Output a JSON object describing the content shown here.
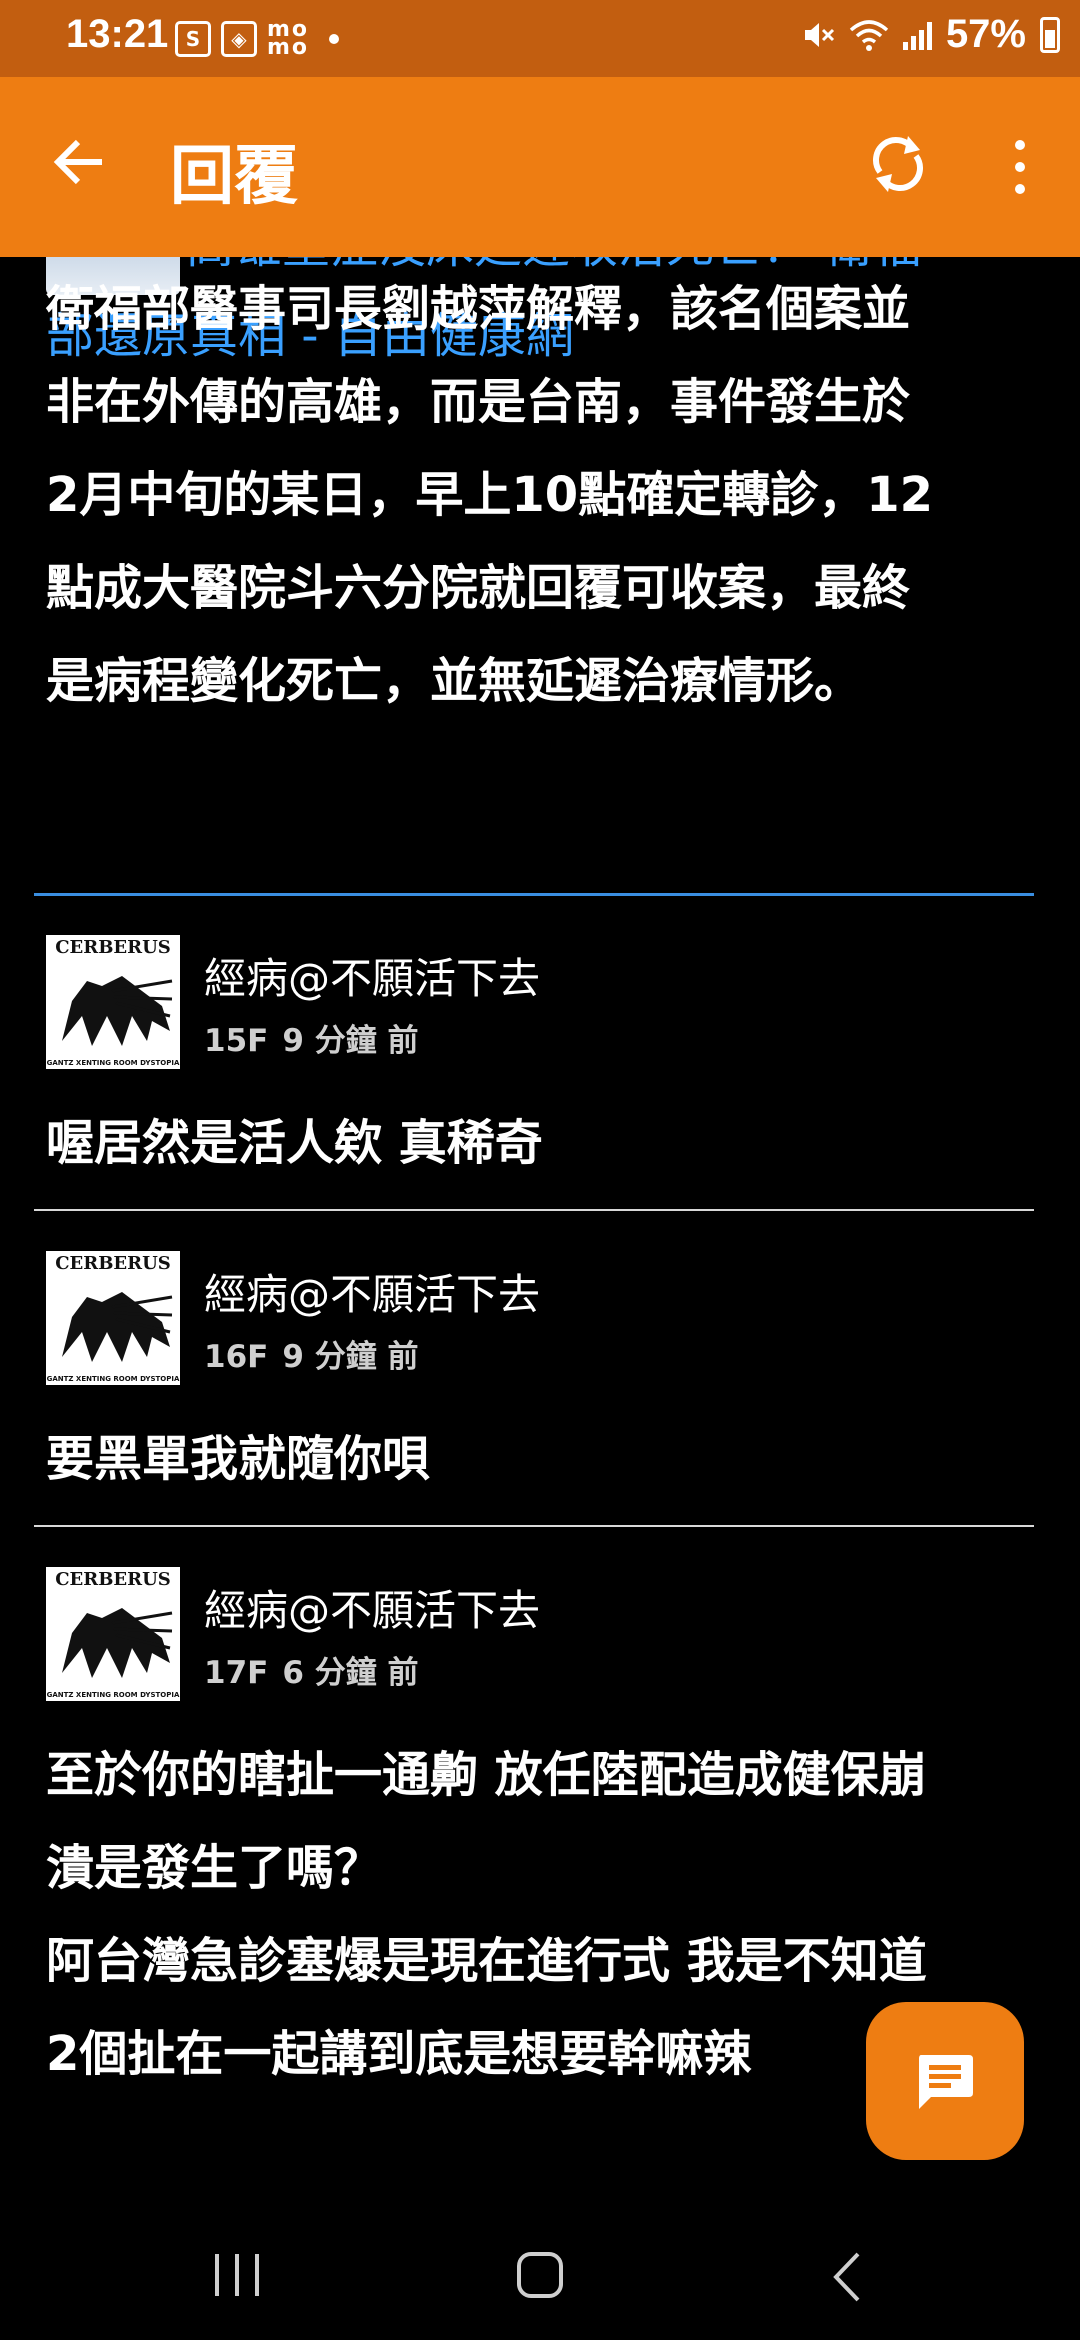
{
  "status_bar": {
    "time": "13:21",
    "notif_icon_1": "S",
    "notif_icon_2": "◈",
    "notif_icon_3": "mo mo",
    "battery": "57%"
  },
  "app_bar": {
    "title": "回覆",
    "back_icon": "arrow-left",
    "refresh_icon": "refresh",
    "more_icon": "more-vertical"
  },
  "post": {
    "link_line1": "高雄重症沒床延遲收治死亡？ 衛福",
    "link_line2": "部還原真相 - 自由健康網",
    "body_lines": [
      "衛福部醫事司長劉越萍解釋，該名個案並",
      "非在外傳的高雄，而是台南，事件發生於",
      "2月中旬的某日，早上10點確定轉診，12",
      "點成大醫院斗六分院就回覆可收案，最終",
      "是病程變化死亡，並無延遲治療情形。"
    ]
  },
  "comments": [
    {
      "avatar_title": "CERBERUS",
      "avatar_footer": "GANTZ XENTING ROOM  DYSTOPIA",
      "name": "經病@不願活下去",
      "floor": "15F",
      "time": "9 分鐘 前",
      "lines": [
        "喔居然是活人欸 真稀奇"
      ]
    },
    {
      "avatar_title": "CERBERUS",
      "avatar_footer": "GANTZ XENTING ROOM  DYSTOPIA",
      "name": "經病@不願活下去",
      "floor": "16F",
      "time": "9 分鐘 前",
      "lines": [
        "要黑單我就隨你唄"
      ]
    },
    {
      "avatar_title": "CERBERUS",
      "avatar_footer": "GANTZ XENTING ROOM  DYSTOPIA",
      "name": "經病@不願活下去",
      "floor": "17F",
      "time": "6 分鐘 前",
      "lines": [
        "至於你的瞎扯一通齁 放任陸配造成健保崩",
        "潰是發生了嗎？",
        "阿台灣急診塞爆是現在進行式 我是不知道",
        "2個扯在一起講到底是想要幹嘛辣"
      ]
    }
  ],
  "fab": {
    "icon": "reply-message-icon"
  },
  "colors": {
    "accent": "#ee7d12",
    "status_bar": "#c25e10",
    "link": "#3aa0ff",
    "divider_blue": "#3a8ee0",
    "background": "#000000"
  }
}
